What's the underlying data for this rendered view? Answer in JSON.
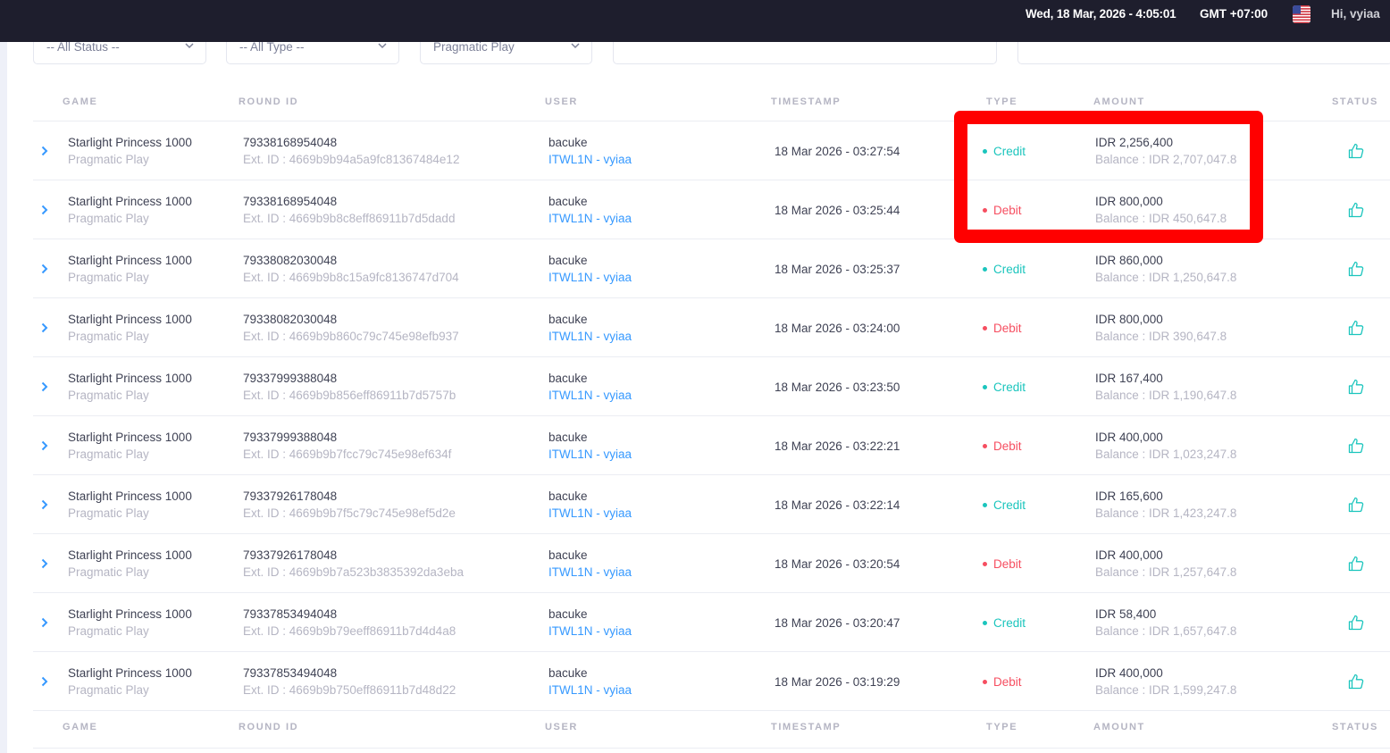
{
  "topbar": {
    "datetime": "Wed, 18 Mar, 2026 - 4:05:01",
    "timezone": "GMT +07:00",
    "greeting": "Hi, vyiaa",
    "flag_icon": "us-flag-icon"
  },
  "filters": {
    "status": "-- All Status --",
    "type": "-- All Type --",
    "provider": "Pragmatic Play"
  },
  "columns": [
    "GAME",
    "ROUND ID",
    "USER",
    "TIMESTAMP",
    "TYPE",
    "AMOUNT",
    "STATUS"
  ],
  "rows": [
    {
      "game": "Starlight Princess 1000",
      "provider": "Pragmatic Play",
      "round_id": "79338168954048",
      "ext_id": "Ext. ID : 4669b9b94a5a9fc81367484e12",
      "user": "bacuke",
      "agent": "ITWL1N - vyiaa",
      "timestamp": "18 Mar 2026 - 03:27:54",
      "type": "Credit",
      "amount": "IDR 2,256,400",
      "balance": "Balance : IDR 2,707,047.8",
      "status_icon": "thumbs-up-icon"
    },
    {
      "game": "Starlight Princess 1000",
      "provider": "Pragmatic Play",
      "round_id": "79338168954048",
      "ext_id": "Ext. ID : 4669b9b8c8eff86911b7d5dadd",
      "user": "bacuke",
      "agent": "ITWL1N - vyiaa",
      "timestamp": "18 Mar 2026 - 03:25:44",
      "type": "Debit",
      "amount": "IDR 800,000",
      "balance": "Balance : IDR 450,647.8",
      "status_icon": "thumbs-up-icon"
    },
    {
      "game": "Starlight Princess 1000",
      "provider": "Pragmatic Play",
      "round_id": "79338082030048",
      "ext_id": "Ext. ID : 4669b9b8c15a9fc8136747d704",
      "user": "bacuke",
      "agent": "ITWL1N - vyiaa",
      "timestamp": "18 Mar 2026 - 03:25:37",
      "type": "Credit",
      "amount": "IDR 860,000",
      "balance": "Balance : IDR 1,250,647.8",
      "status_icon": "thumbs-up-icon"
    },
    {
      "game": "Starlight Princess 1000",
      "provider": "Pragmatic Play",
      "round_id": "79338082030048",
      "ext_id": "Ext. ID : 4669b9b860c79c745e98efb937",
      "user": "bacuke",
      "agent": "ITWL1N - vyiaa",
      "timestamp": "18 Mar 2026 - 03:24:00",
      "type": "Debit",
      "amount": "IDR 800,000",
      "balance": "Balance : IDR 390,647.8",
      "status_icon": "thumbs-up-icon"
    },
    {
      "game": "Starlight Princess 1000",
      "provider": "Pragmatic Play",
      "round_id": "79337999388048",
      "ext_id": "Ext. ID : 4669b9b856eff86911b7d5757b",
      "user": "bacuke",
      "agent": "ITWL1N - vyiaa",
      "timestamp": "18 Mar 2026 - 03:23:50",
      "type": "Credit",
      "amount": "IDR 167,400",
      "balance": "Balance : IDR 1,190,647.8",
      "status_icon": "thumbs-up-icon"
    },
    {
      "game": "Starlight Princess 1000",
      "provider": "Pragmatic Play",
      "round_id": "79337999388048",
      "ext_id": "Ext. ID : 4669b9b7fcc79c745e98ef634f",
      "user": "bacuke",
      "agent": "ITWL1N - vyiaa",
      "timestamp": "18 Mar 2026 - 03:22:21",
      "type": "Debit",
      "amount": "IDR 400,000",
      "balance": "Balance : IDR 1,023,247.8",
      "status_icon": "thumbs-up-icon"
    },
    {
      "game": "Starlight Princess 1000",
      "provider": "Pragmatic Play",
      "round_id": "79337926178048",
      "ext_id": "Ext. ID : 4669b9b7f5c79c745e98ef5d2e",
      "user": "bacuke",
      "agent": "ITWL1N - vyiaa",
      "timestamp": "18 Mar 2026 - 03:22:14",
      "type": "Credit",
      "amount": "IDR 165,600",
      "balance": "Balance : IDR 1,423,247.8",
      "status_icon": "thumbs-up-icon"
    },
    {
      "game": "Starlight Princess 1000",
      "provider": "Pragmatic Play",
      "round_id": "79337926178048",
      "ext_id": "Ext. ID : 4669b9b7a523b3835392da3eba",
      "user": "bacuke",
      "agent": "ITWL1N - vyiaa",
      "timestamp": "18 Mar 2026 - 03:20:54",
      "type": "Debit",
      "amount": "IDR 400,000",
      "balance": "Balance : IDR 1,257,647.8",
      "status_icon": "thumbs-up-icon"
    },
    {
      "game": "Starlight Princess 1000",
      "provider": "Pragmatic Play",
      "round_id": "79337853494048",
      "ext_id": "Ext. ID : 4669b9b79eeff86911b7d4d4a8",
      "user": "bacuke",
      "agent": "ITWL1N - vyiaa",
      "timestamp": "18 Mar 2026 - 03:20:47",
      "type": "Credit",
      "amount": "IDR 58,400",
      "balance": "Balance : IDR 1,657,647.8",
      "status_icon": "thumbs-up-icon"
    },
    {
      "game": "Starlight Princess 1000",
      "provider": "Pragmatic Play",
      "round_id": "79337853494048",
      "ext_id": "Ext. ID : 4669b9b750eff86911b7d48d22",
      "user": "bacuke",
      "agent": "ITWL1N - vyiaa",
      "timestamp": "18 Mar 2026 - 03:19:29",
      "type": "Debit",
      "amount": "IDR 400,000",
      "balance": "Balance : IDR 1,599,247.8",
      "status_icon": "thumbs-up-icon"
    }
  ],
  "colors": {
    "credit": "#1bc5bd",
    "debit": "#f64e60",
    "link": "#3699ff",
    "highlight": "#ff0000",
    "topbar": "#1e1e2d"
  }
}
